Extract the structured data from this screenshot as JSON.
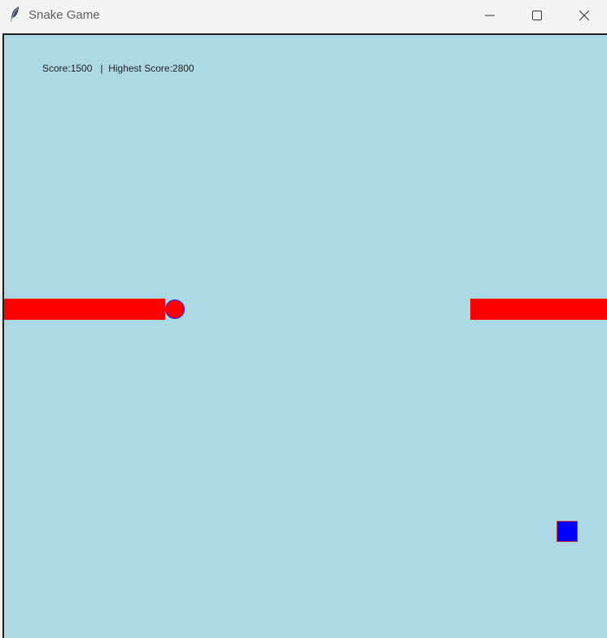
{
  "window": {
    "title": "Snake Game",
    "controls": {
      "minimize": "minimize-icon",
      "maximize": "maximize-icon",
      "close": "close-icon"
    }
  },
  "game": {
    "score_label": "Score:",
    "score": "1500",
    "separator": "|",
    "highest_label": "Highest Score:",
    "highest_score": "2800",
    "colors": {
      "background": "#add8e6",
      "snake": "#ff0000",
      "snake_head_outline": "#2222ee",
      "food": "#0000ff",
      "food_outline": "#c0392b"
    }
  }
}
